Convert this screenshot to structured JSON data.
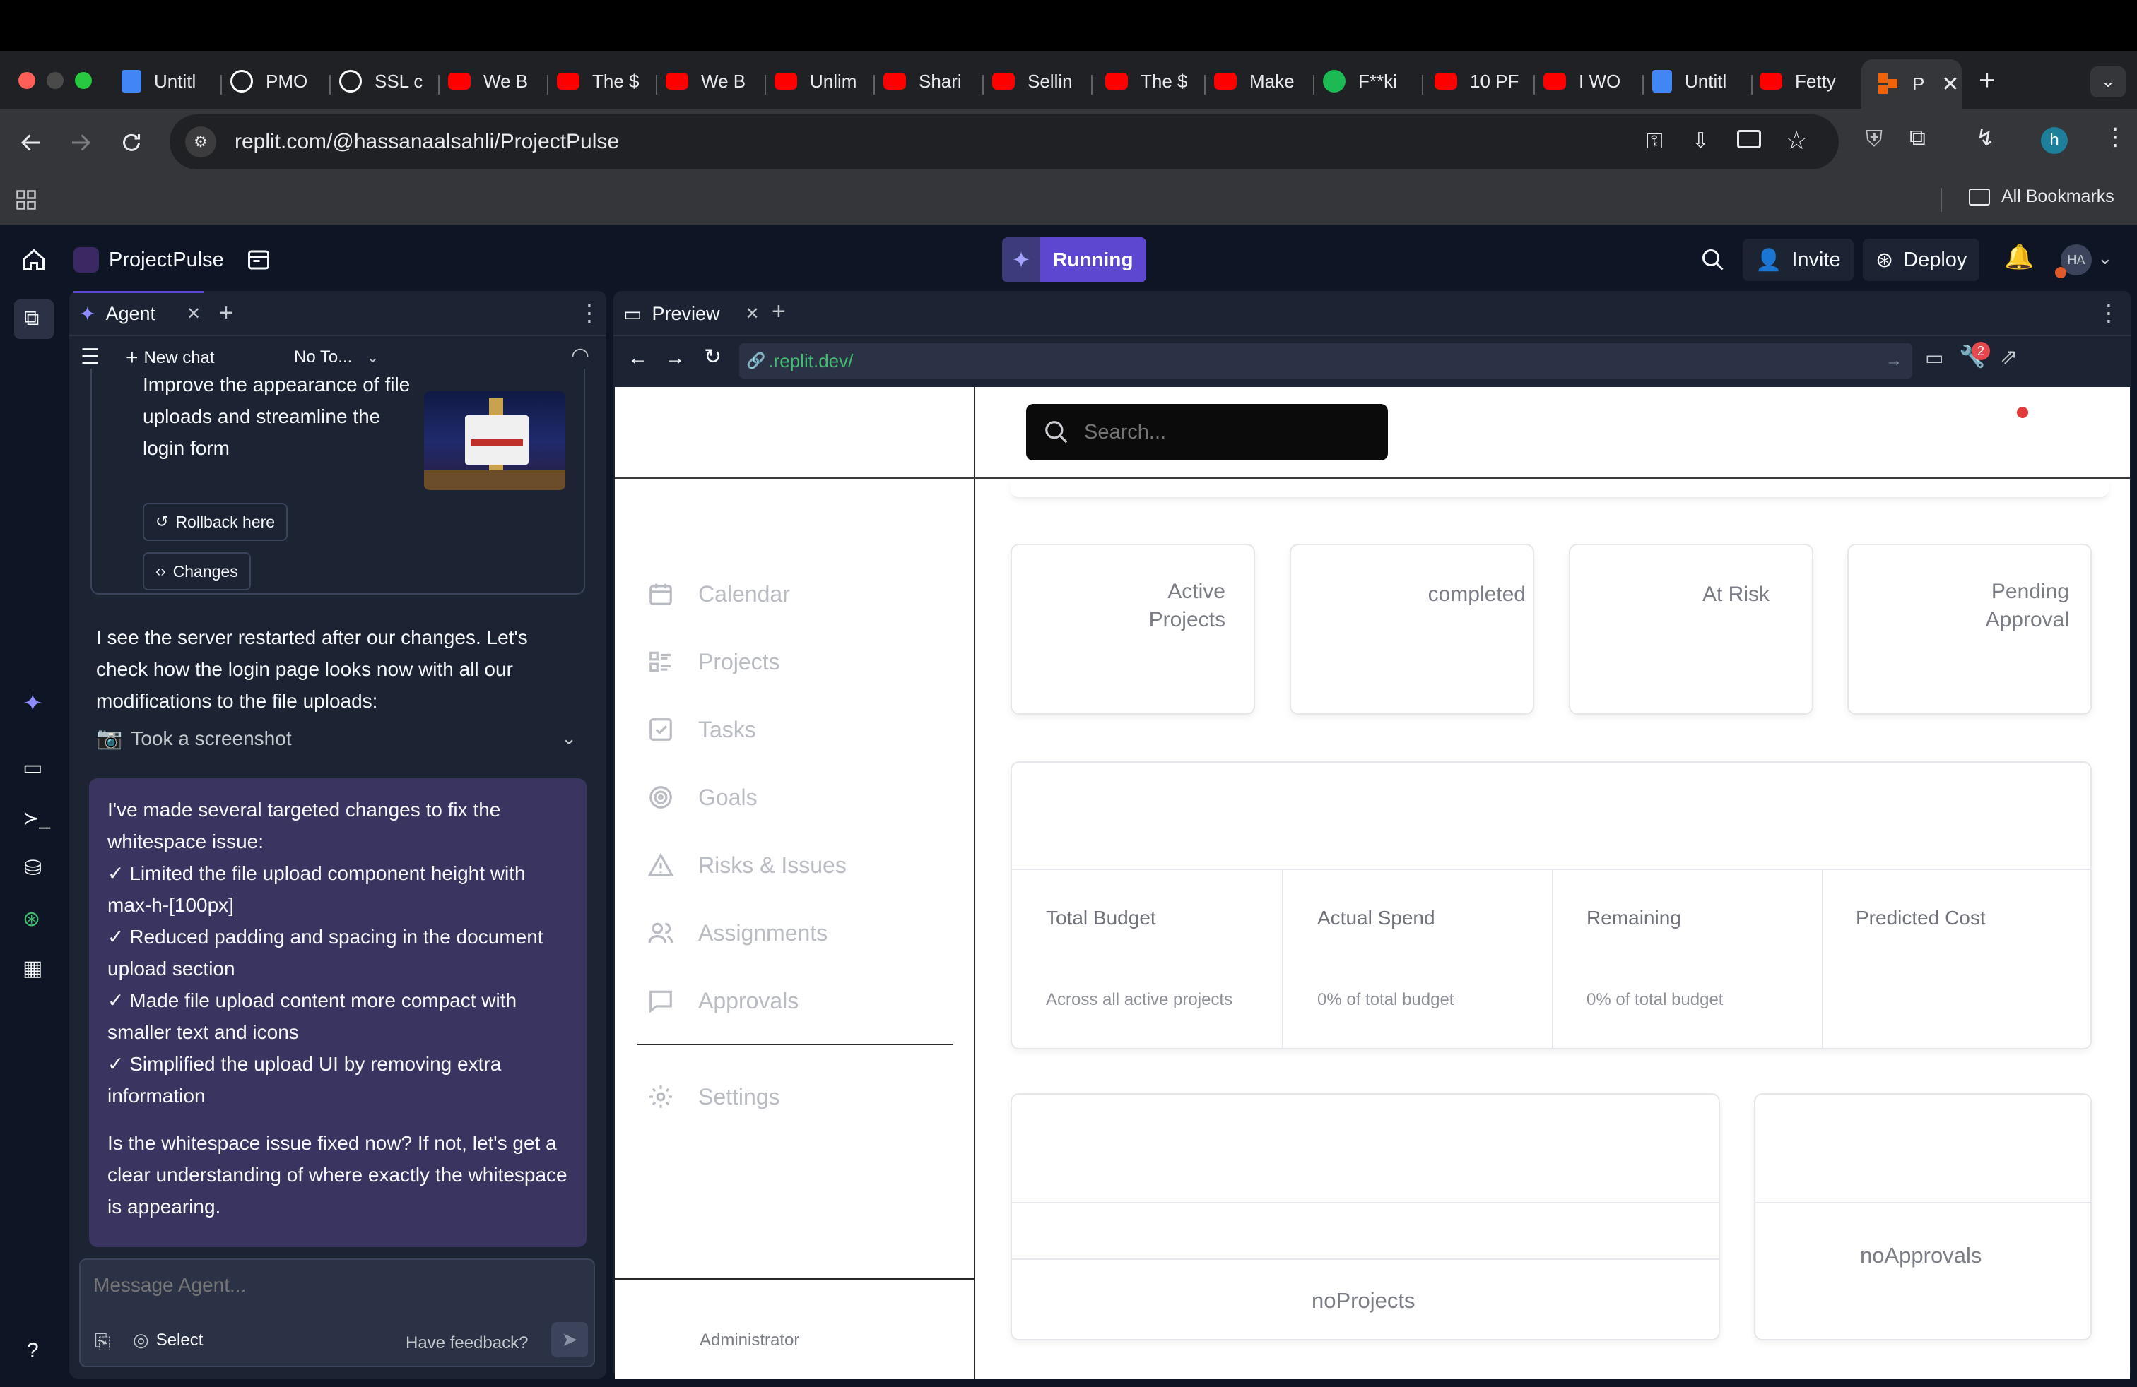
{
  "browser": {
    "tabs": [
      {
        "label": "Untitl",
        "icon": "google-docs-icon",
        "color": "#4285f4"
      },
      {
        "label": "PMO",
        "icon": "openai-icon",
        "color": "#ffffff"
      },
      {
        "label": "SSL c",
        "icon": "openai-icon",
        "color": "#ffffff"
      },
      {
        "label": "We B",
        "icon": "youtube-icon",
        "color": "#ff0000"
      },
      {
        "label": "The $",
        "icon": "youtube-icon",
        "color": "#ff0000"
      },
      {
        "label": "We B",
        "icon": "youtube-icon",
        "color": "#ff0000"
      },
      {
        "label": "Unlim",
        "icon": "youtube-icon",
        "color": "#ff0000"
      },
      {
        "label": "Shari",
        "icon": "youtube-icon",
        "color": "#ff0000"
      },
      {
        "label": "Sellin",
        "icon": "youtube-icon",
        "color": "#ff0000"
      },
      {
        "label": "The $",
        "icon": "youtube-icon",
        "color": "#ff0000"
      },
      {
        "label": "Make",
        "icon": "youtube-icon",
        "color": "#ff0000"
      },
      {
        "label": "F**ki",
        "icon": "spotify-icon",
        "color": "#1db954"
      },
      {
        "label": "10 PF",
        "icon": "youtube-icon",
        "color": "#ff0000"
      },
      {
        "label": "I WO",
        "icon": "youtube-icon",
        "color": "#ff0000"
      },
      {
        "label": "Untitl",
        "icon": "google-docs-icon",
        "color": "#4285f4"
      },
      {
        "label": "Fetty",
        "icon": "youtube-icon",
        "color": "#ff0000"
      }
    ],
    "active_tab": {
      "label": "P",
      "icon": "replit-icon"
    },
    "url": "replit.com/@hassanaalsahli/ProjectPulse",
    "bookmarks_label": "All Bookmarks",
    "profile_initial": "h"
  },
  "replit": {
    "project_name": "ProjectPulse",
    "run_status": "Running",
    "invite_label": "Invite",
    "deploy_label": "Deploy",
    "avatar_initials": "HA",
    "agent": {
      "tab_label": "Agent",
      "new_chat_label": "New chat",
      "model_select": "No To...",
      "checkpoint": {
        "text": "Improve the appearance of file uploads and streamline the login form",
        "rollback_label": "Rollback here",
        "changes_label": "Changes"
      },
      "message_1": "I see the server restarted after our changes. Let's check how the login page looks now with all our modifications to the file uploads:",
      "screenshot_label": "Took a screenshot",
      "message_2": {
        "intro": "I've made several targeted changes to fix the whitespace issue:",
        "items": [
          "✓ Limited the file upload component height with max-h-[100px]",
          "✓ Reduced padding and spacing in the document upload section",
          "✓ Made file upload content more compact with smaller text and icons",
          "✓ Simplified the upload UI by removing extra information"
        ],
        "question": "Is the whitespace issue fixed now? If not, let's get a clear understanding of where exactly the whitespace is appearing."
      },
      "input_placeholder": "Message Agent...",
      "select_label": "Select",
      "feedback_label": "Have feedback?"
    },
    "preview": {
      "tab_label": "Preview",
      "url": ".replit.dev/",
      "badge_count": "2"
    }
  },
  "site": {
    "search_placeholder": "Search...",
    "nav": [
      {
        "label": "Calendar",
        "icon": "calendar-icon"
      },
      {
        "label": "Projects",
        "icon": "projects-icon"
      },
      {
        "label": "Tasks",
        "icon": "tasks-icon"
      },
      {
        "label": "Goals",
        "icon": "goals-icon"
      },
      {
        "label": "Risks & Issues",
        "icon": "warning-icon"
      },
      {
        "label": "Assignments",
        "icon": "users-icon"
      },
      {
        "label": "Approvals",
        "icon": "message-icon"
      }
    ],
    "settings_label": "Settings",
    "user_role": "Administrator",
    "stats": [
      "Active Projects",
      "completed",
      "At Risk",
      "Pending Approval"
    ],
    "budget": [
      {
        "label": "Total Budget",
        "sub": "Across all active projects"
      },
      {
        "label": "Actual Spend",
        "sub": "0% of total budget"
      },
      {
        "label": "Remaining",
        "sub": "0% of total budget"
      },
      {
        "label": "Predicted Cost",
        "sub": ""
      }
    ],
    "no_projects": "noProjects",
    "no_approvals": "noApprovals"
  }
}
